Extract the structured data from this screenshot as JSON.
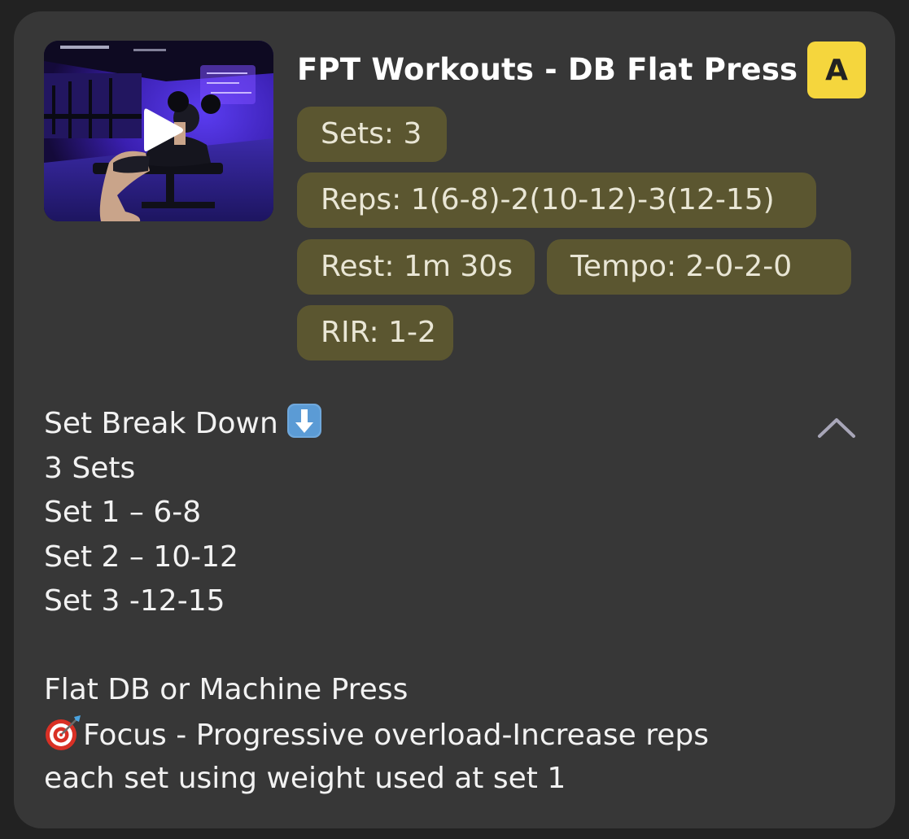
{
  "card": {
    "title": "FPT Workouts - DB Flat Press",
    "badge": "A",
    "chips": {
      "sets": "Sets: 3",
      "reps": "Reps: 1(6-8)-2(10-12)-3(12-15)",
      "rest": "Rest: 1m 30s",
      "tempo": "Tempo: 2-0-2-0",
      "rir": "RIR: 1-2"
    },
    "description": {
      "header": "Set Break Down",
      "header_icon": "down-arrow-emoji",
      "lines": [
        "3 Sets",
        "Set 1 – 6-8",
        "Set 2 – 10-12",
        "Set 3 -12-15"
      ],
      "exercise": "Flat DB or Machine Press",
      "focus_icon": "dart-target-emoji",
      "focus_line1": "Focus - Progressive overload-Increase reps",
      "focus_line2": "each set using weight used at set 1"
    },
    "collapse_icon": "chevron-up-icon",
    "video_icon": "play-icon"
  },
  "colors": {
    "background": "#222222",
    "card": "#373737",
    "chip": "#5b5630",
    "chip_text": "#e9e6d5",
    "badge": "#f5d63d",
    "accent_video": "#4b2bd6"
  }
}
